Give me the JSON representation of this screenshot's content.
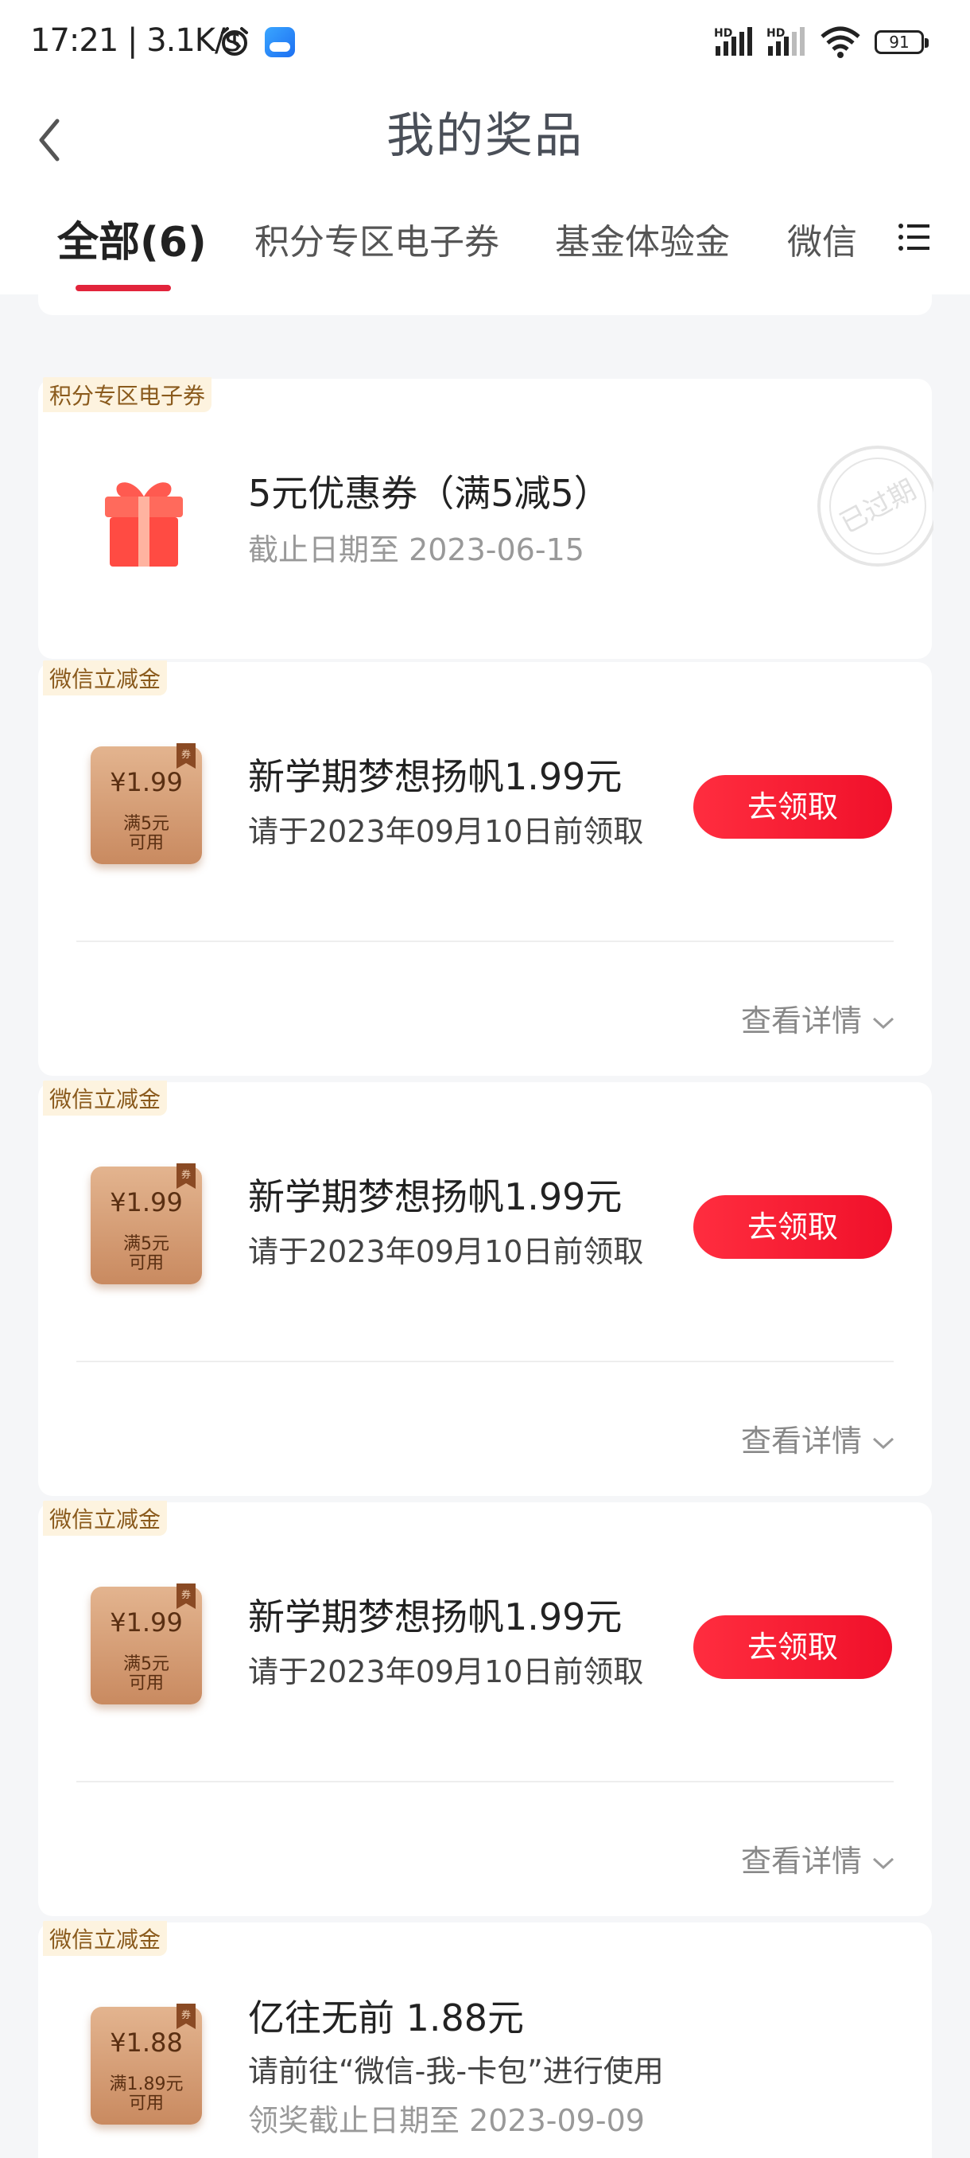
{
  "status_bar": {
    "time": "17:21",
    "speed": "3.1K/s",
    "hd1": "HD",
    "hd2": "HD",
    "battery": "91"
  },
  "header": {
    "title": "我的奖品"
  },
  "tabs": [
    {
      "label": "全部(6)",
      "active": true
    },
    {
      "label": "积分专区电子券",
      "active": false
    },
    {
      "label": "基金体验金",
      "active": false
    },
    {
      "label": "微信",
      "active": false
    }
  ],
  "prizes": [
    {
      "tag": "积分专区电子券",
      "title": "5元优惠券（满5减5）",
      "deadline": "截止日期至 2023-06-15",
      "status": "已过期"
    },
    {
      "tag": "微信立减金",
      "title": "新学期梦想扬帆1.99元",
      "subtitle": "请于2023年09月10日前领取",
      "coupon_amount": "¥1.99",
      "coupon_condition_line1": "满5元",
      "coupon_condition_line2": "可用",
      "coupon_flag": "券",
      "claim_label": "去领取",
      "details_label": "查看详情"
    },
    {
      "tag": "微信立减金",
      "title": "新学期梦想扬帆1.99元",
      "subtitle": "请于2023年09月10日前领取",
      "coupon_amount": "¥1.99",
      "coupon_condition_line1": "满5元",
      "coupon_condition_line2": "可用",
      "coupon_flag": "券",
      "claim_label": "去领取",
      "details_label": "查看详情"
    },
    {
      "tag": "微信立减金",
      "title": "新学期梦想扬帆1.99元",
      "subtitle": "请于2023年09月10日前领取",
      "coupon_amount": "¥1.99",
      "coupon_condition_line1": "满5元",
      "coupon_condition_line2": "可用",
      "coupon_flag": "券",
      "claim_label": "去领取",
      "details_label": "查看详情"
    },
    {
      "tag": "微信立减金",
      "title": "亿往无前 1.88元",
      "subtitle": "请前往“微信-我-卡包”进行使用",
      "deadline": "领奖截止日期至 2023-09-09",
      "coupon_amount": "¥1.88",
      "coupon_condition_line1": "满1.89元",
      "coupon_condition_line2": "可用",
      "coupon_flag": "券"
    }
  ],
  "colors": {
    "accent_red": "#e2243b",
    "tag_bg": "#fdf3df",
    "tag_text": "#8a5a1c",
    "coupon": "#d49a6f"
  }
}
